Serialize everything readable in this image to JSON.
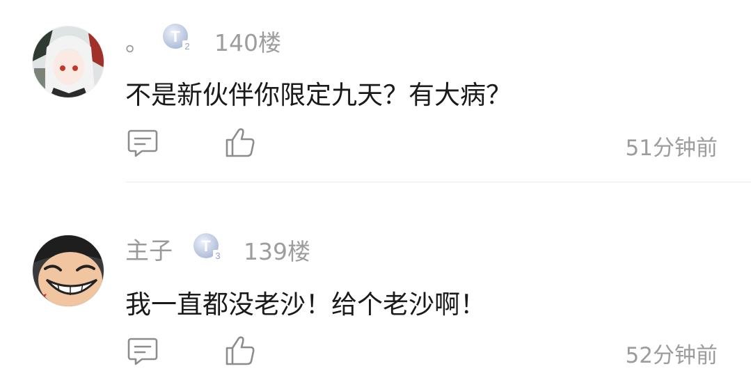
{
  "comments": [
    {
      "username": "。",
      "level_badge": "T",
      "level_number": "2",
      "floor": "140楼",
      "text": "不是新伙伴你限定九天？有大病？",
      "time": "51分钟前"
    },
    {
      "username": "主子",
      "level_badge": "T",
      "level_number": "3",
      "floor": "139楼",
      "text": "我一直都没老沙！给个老沙啊！",
      "time": "52分钟前"
    }
  ],
  "icons": {
    "reply": "comment-icon",
    "like": "thumbs-up-icon"
  },
  "colors": {
    "secondary_text": "#9a9a9a",
    "primary_text": "#1a1a1a",
    "badge": "#aebfdc"
  }
}
